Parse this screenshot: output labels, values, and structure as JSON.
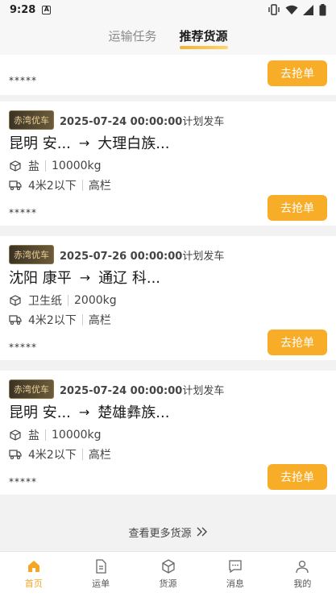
{
  "status": {
    "time": "9:28",
    "notif": "A"
  },
  "header": {
    "tabs": [
      {
        "label": "运输任务",
        "active": false
      },
      {
        "label": "推荐货源",
        "active": true
      }
    ]
  },
  "cards": [
    {
      "stars": "*****",
      "button": "去抢单"
    },
    {
      "badge": "赤湾优车",
      "date": "2025-07-24 00:00:00",
      "date_suffix": "计划发车",
      "from": "昆明 安...",
      "arrow": "→",
      "to": "大理白族...",
      "goods": "盐",
      "weight": "10000kg",
      "truck_size": "4米2以下",
      "truck_type": "高栏",
      "stars": "*****",
      "button": "去抢单"
    },
    {
      "badge": "赤湾优车",
      "date": "2025-07-26 00:00:00",
      "date_suffix": "计划发车",
      "from": "沈阳 康平",
      "arrow": "→",
      "to": "通辽 科...",
      "goods": "卫生纸",
      "weight": "2000kg",
      "truck_size": "4米2以下",
      "truck_type": "高栏",
      "stars": "*****",
      "button": "去抢单"
    },
    {
      "badge": "赤湾优车",
      "date": "2025-07-24 00:00:00",
      "date_suffix": "计划发车",
      "from": "昆明 安...",
      "arrow": "→",
      "to": "楚雄彝族...",
      "goods": "盐",
      "weight": "10000kg",
      "truck_size": "4米2以下",
      "truck_type": "高栏",
      "stars": "*****",
      "button": "去抢单"
    }
  ],
  "more": {
    "label": "查看更多货源",
    "icon": "double-chevron-right-icon"
  },
  "tabbar": {
    "items": [
      {
        "label": "首页",
        "icon": "home-icon",
        "active": true
      },
      {
        "label": "运单",
        "icon": "document-icon",
        "active": false
      },
      {
        "label": "货源",
        "icon": "box-icon",
        "active": false
      },
      {
        "label": "消息",
        "icon": "message-icon",
        "active": false
      },
      {
        "label": "我的",
        "icon": "user-icon",
        "active": false
      }
    ]
  },
  "colors": {
    "accent": "#f8ad28",
    "badge_text": "#f0d39a"
  }
}
